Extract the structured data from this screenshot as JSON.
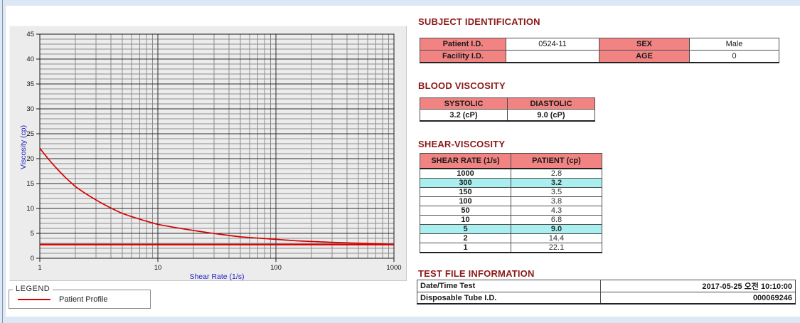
{
  "colors": {
    "page_bg": "#dce8f5",
    "panel_bg": "#ececec",
    "header_pink": "#f18383",
    "highlight_cyan": "#aaefef",
    "title_maroon": "#8b1717",
    "curve_red": "#d40000",
    "axis_label_blue": "#2323c0",
    "grid_minor": "#8c8c8c",
    "grid_major": "#2e2e2e"
  },
  "chart_data": {
    "type": "line",
    "title": "",
    "xlabel": "Shear Rate (1/s)",
    "ylabel": "Viscosity (cp)",
    "x_scale": "log",
    "xlim": [
      1,
      1000
    ],
    "ylim": [
      0,
      45
    ],
    "x_ticks": [
      1,
      10,
      100,
      1000
    ],
    "y_ticks": [
      0,
      5,
      10,
      15,
      20,
      25,
      30,
      35,
      40,
      45
    ],
    "y_minor_step": 1,
    "grid": true,
    "legend_position": "below-left",
    "series": [
      {
        "name": "Patient Profile",
        "color": "#d40000",
        "x": [
          1,
          2,
          5,
          10,
          50,
          100,
          150,
          300,
          1000
        ],
        "y": [
          22.1,
          14.4,
          9.0,
          6.8,
          4.3,
          3.8,
          3.5,
          3.2,
          2.8
        ]
      },
      {
        "name": "asymptote-line",
        "color": "#d40000",
        "type": "hline",
        "value": 2.75
      }
    ]
  },
  "legend": {
    "title": "LEGEND",
    "entry": "Patient Profile"
  },
  "subject": {
    "title": "SUBJECT IDENTIFICATION",
    "patient_id_label": "Patient I.D.",
    "patient_id": "0524-11",
    "sex_label": "SEX",
    "sex": "Male",
    "facility_id_label": "Facility I.D.",
    "facility_id": "",
    "age_label": "AGE",
    "age": "0"
  },
  "blood_viscosity": {
    "title": "BLOOD VISCOSITY",
    "systolic_label": "SYSTOLIC",
    "diastolic_label": "DIASTOLIC",
    "systolic": "3.2 (cP)",
    "diastolic": "9.0 (cP)"
  },
  "shear_viscosity": {
    "title": "SHEAR-VISCOSITY",
    "col_rate": "SHEAR RATE (1/s)",
    "col_patient": "PATIENT (cp)",
    "rows": [
      {
        "rate": "1000",
        "patient": "2.8",
        "highlight": false
      },
      {
        "rate": "300",
        "patient": "3.2",
        "highlight": true
      },
      {
        "rate": "150",
        "patient": "3.5",
        "highlight": false
      },
      {
        "rate": "100",
        "patient": "3.8",
        "highlight": false
      },
      {
        "rate": "50",
        "patient": "4.3",
        "highlight": false
      },
      {
        "rate": "10",
        "patient": "6.8",
        "highlight": false
      },
      {
        "rate": "5",
        "patient": "9.0",
        "highlight": true
      },
      {
        "rate": "2",
        "patient": "14.4",
        "highlight": false
      },
      {
        "rate": "1",
        "patient": "22.1",
        "highlight": false
      }
    ]
  },
  "test_file": {
    "title": "TEST FILE INFORMATION",
    "date_label": "Date/Time Test",
    "date_value": "2017-05-25  오전 10:10:00",
    "tube_label": "Disposable Tube I.D.",
    "tube_value": "000069246"
  }
}
